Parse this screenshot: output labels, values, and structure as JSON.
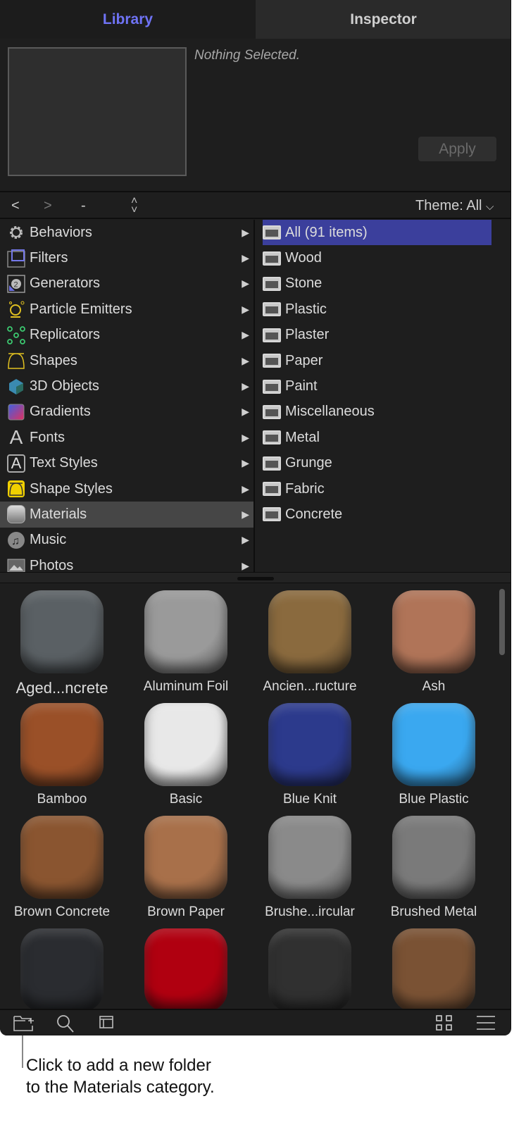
{
  "tabs": [
    {
      "label": "Library",
      "active": true
    },
    {
      "label": "Inspector",
      "active": false
    }
  ],
  "preview": {
    "status": "Nothing Selected.",
    "apply_label": "Apply"
  },
  "nav": {
    "back": "<",
    "forward": ">",
    "path": "-",
    "theme_label": "Theme: All"
  },
  "categories": [
    {
      "label": "Behaviors",
      "icon": "gear-icon"
    },
    {
      "label": "Filters",
      "icon": "film-icon"
    },
    {
      "label": "Generators",
      "icon": "generator-icon"
    },
    {
      "label": "Particle Emitters",
      "icon": "emitter-icon"
    },
    {
      "label": "Replicators",
      "icon": "replicator-icon"
    },
    {
      "label": "Shapes",
      "icon": "shape-icon"
    },
    {
      "label": "3D Objects",
      "icon": "cube-icon"
    },
    {
      "label": "Gradients",
      "icon": "gradient-icon"
    },
    {
      "label": "Fonts",
      "icon": "font-icon"
    },
    {
      "label": "Text Styles",
      "icon": "text-style-icon"
    },
    {
      "label": "Shape Styles",
      "icon": "shape-style-icon"
    },
    {
      "label": "Materials",
      "icon": "material-icon",
      "selected": true
    },
    {
      "label": "Music",
      "icon": "music-icon"
    },
    {
      "label": "Photos",
      "icon": "photo-icon"
    }
  ],
  "folders": [
    {
      "label": "All (91 items)",
      "selected": true
    },
    {
      "label": "Wood"
    },
    {
      "label": "Stone"
    },
    {
      "label": "Plastic"
    },
    {
      "label": "Plaster"
    },
    {
      "label": "Paper"
    },
    {
      "label": "Paint"
    },
    {
      "label": "Miscellaneous"
    },
    {
      "label": "Metal"
    },
    {
      "label": "Grunge"
    },
    {
      "label": "Fabric"
    },
    {
      "label": "Concrete"
    }
  ],
  "materials": [
    {
      "label": "Aged...ncrete",
      "color": "#5a6064"
    },
    {
      "label": "Aluminum Foil",
      "color": "#9a9a9a"
    },
    {
      "label": "Ancien...ructure",
      "color": "#8a6a3e"
    },
    {
      "label": "Ash",
      "color": "#b07458"
    },
    {
      "label": "Bamboo",
      "color": "#9a5028"
    },
    {
      "label": "Basic",
      "color": "#e8e8e8"
    },
    {
      "label": "Blue Knit",
      "color": "#2c3a8c"
    },
    {
      "label": "Blue Plastic",
      "color": "#3aa8f0"
    },
    {
      "label": "Brown Concrete",
      "color": "#8a5530"
    },
    {
      "label": "Brown Paper",
      "color": "#a8704a"
    },
    {
      "label": "Brushe...ircular",
      "color": "#8a8a8a"
    },
    {
      "label": "Brushed Metal",
      "color": "#7a7a7a"
    },
    {
      "label": "",
      "color": "#2a2c30"
    },
    {
      "label": "",
      "color": "#b00010"
    },
    {
      "label": "",
      "color": "#303030"
    },
    {
      "label": "",
      "color": "#7a5234"
    }
  ],
  "toolbar": {
    "new_folder": "new-folder-icon",
    "search": "search-icon",
    "preview_toggle": "preview-icon",
    "grid_view": "grid-icon",
    "list_view": "list-icon"
  },
  "callout": {
    "line1": "Click to add a new folder",
    "line2": "to the Materials category."
  }
}
